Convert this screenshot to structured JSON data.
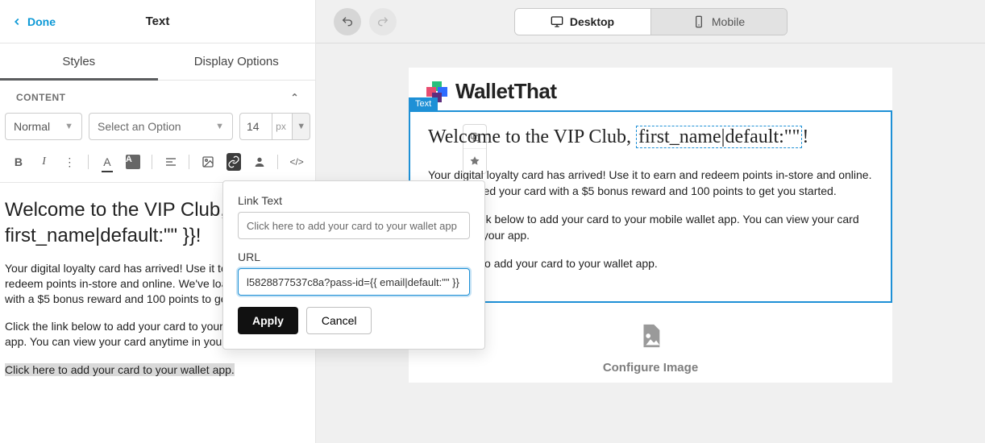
{
  "left": {
    "back_label": "Done",
    "title": "Text",
    "tabs": {
      "styles": "Styles",
      "display": "Display Options"
    },
    "section_label": "CONTENT",
    "normal": "Normal",
    "select_option": "Select an Option",
    "font_size": "14",
    "font_unit": "px"
  },
  "popover": {
    "link_text_label": "Link Text",
    "link_text_value": "Click here to add your card to your wallet app",
    "url_label": "URL",
    "url_value": "l5828877537c8a?pass-id={{ email|default:\"\" }}",
    "apply": "Apply",
    "cancel": "Cancel"
  },
  "editor": {
    "heading": "Welcome to the VIP Club, first_name|default:\"\" }}!",
    "p1": "Your digital loyalty card has arrived! Use it to earn and redeem points in-store and online. We've loaded your card with a $5 bonus reward and 100 points to get you started.",
    "p2": "Click the link below to add your card to your mobile wallet app. You can view your card anytime in your app.",
    "p3": "Click here to add your card to your wallet app."
  },
  "right": {
    "desktop": "Desktop",
    "mobile": "Mobile"
  },
  "preview": {
    "brand": "WalletThat",
    "tag": "Text",
    "heading_pre": "Welcome to the VIP Club, ",
    "heading_var": "first_name|default:\"\"",
    "heading_post": "!",
    "p1": "Your digital loyalty card has arrived! Use it to earn and redeem points in-store and online. We've loaded your card with a $5 bonus reward and 100 points to get you started.",
    "p2": "Click the link below to add your card to your mobile wallet app. You can view your card anytime in your app.",
    "p3": "Click here to add your card to your wallet app.",
    "img_caption": "Configure Image"
  }
}
